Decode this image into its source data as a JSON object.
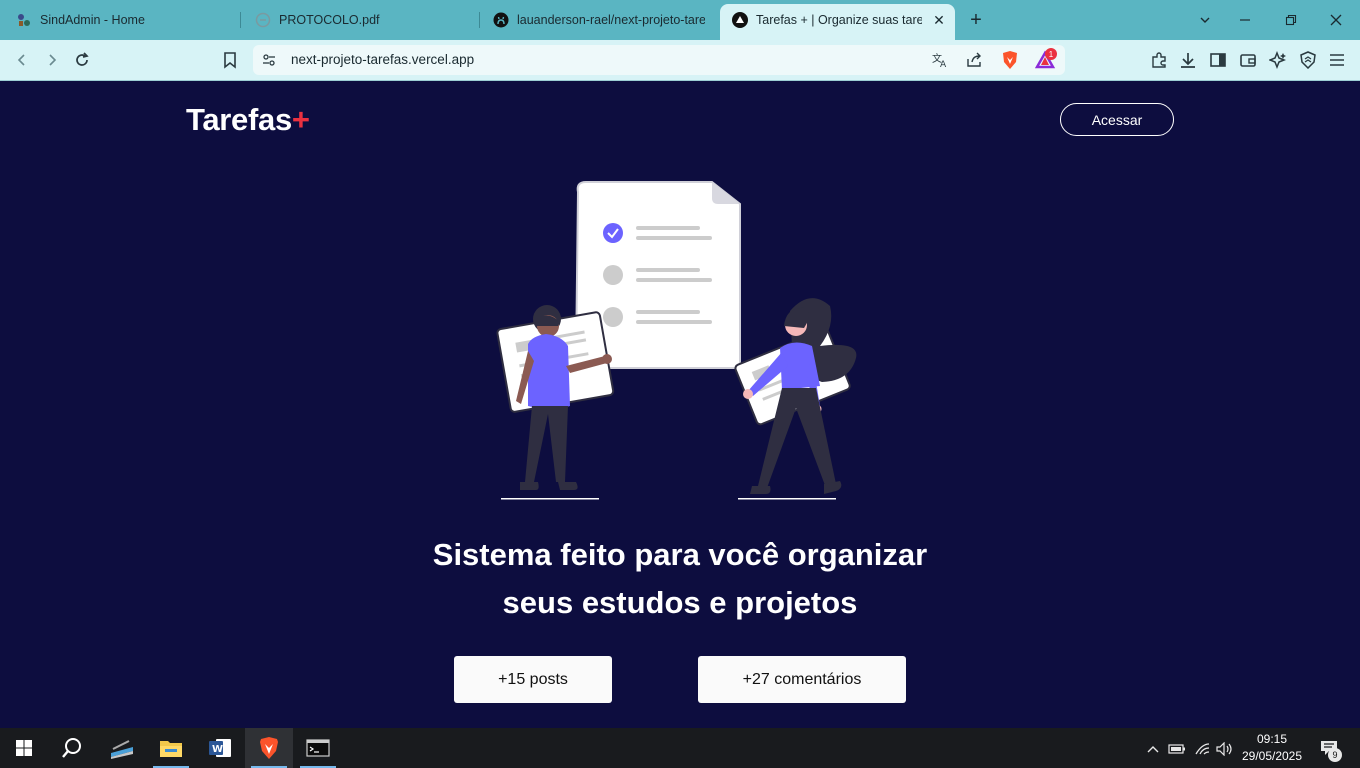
{
  "browser": {
    "tabs": [
      {
        "label": "SindAdmin - Home",
        "icon": "sindadmin-icon"
      },
      {
        "label": "PROTOCOLO.pdf",
        "icon": "pdf-icon"
      },
      {
        "label": "lauanderson-rael/next-projeto-tarefas",
        "icon": "github-icon"
      },
      {
        "label": "Tarefas + | Organize suas tarefas",
        "icon": "vercel-icon"
      }
    ],
    "url": "next-projeto-tarefas.vercel.app",
    "rewards_badge": "1"
  },
  "page": {
    "logo_text": "Tarefas",
    "logo_plus": "+",
    "access_button": "Acessar",
    "headline_line1": "Sistema feito para você organizar",
    "headline_line2": "seus estudos e projetos",
    "stats": [
      {
        "label": "+15 posts"
      },
      {
        "label": "+27 comentários"
      }
    ]
  },
  "taskbar": {
    "time": "09:15",
    "date": "29/05/2025",
    "notifications": "9"
  },
  "colors": {
    "page_bg": "#0d0d3f",
    "accent_plus": "#ea3140",
    "tab_strip": "#5ab5c2",
    "illustration_accent": "#6c63ff"
  }
}
